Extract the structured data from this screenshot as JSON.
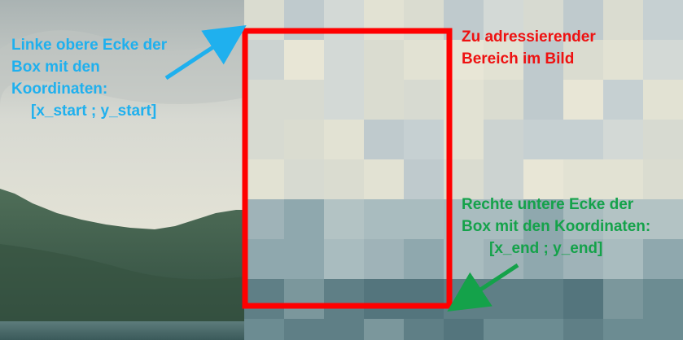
{
  "colors": {
    "box": "#ff0000",
    "top_left_label": "#1fb0ee",
    "region_label": "#ee1111",
    "bottom_right_label": "#14a24a",
    "top_left_arrow": "#1fb0ee",
    "bottom_right_arrow": "#14a24a"
  },
  "annotations": {
    "top_left": {
      "lines": [
        "Linke obere Ecke der",
        "Box mit den",
        "Koordinaten:",
        "[x_start ; y_start]"
      ]
    },
    "region": {
      "lines": [
        "Zu adressierender",
        "Bereich im Bild"
      ]
    },
    "bottom_right": {
      "lines": [
        "Rechte untere Ecke der",
        "Box mit den Koordinaten:",
        "[x_end ; y_end]"
      ]
    }
  }
}
